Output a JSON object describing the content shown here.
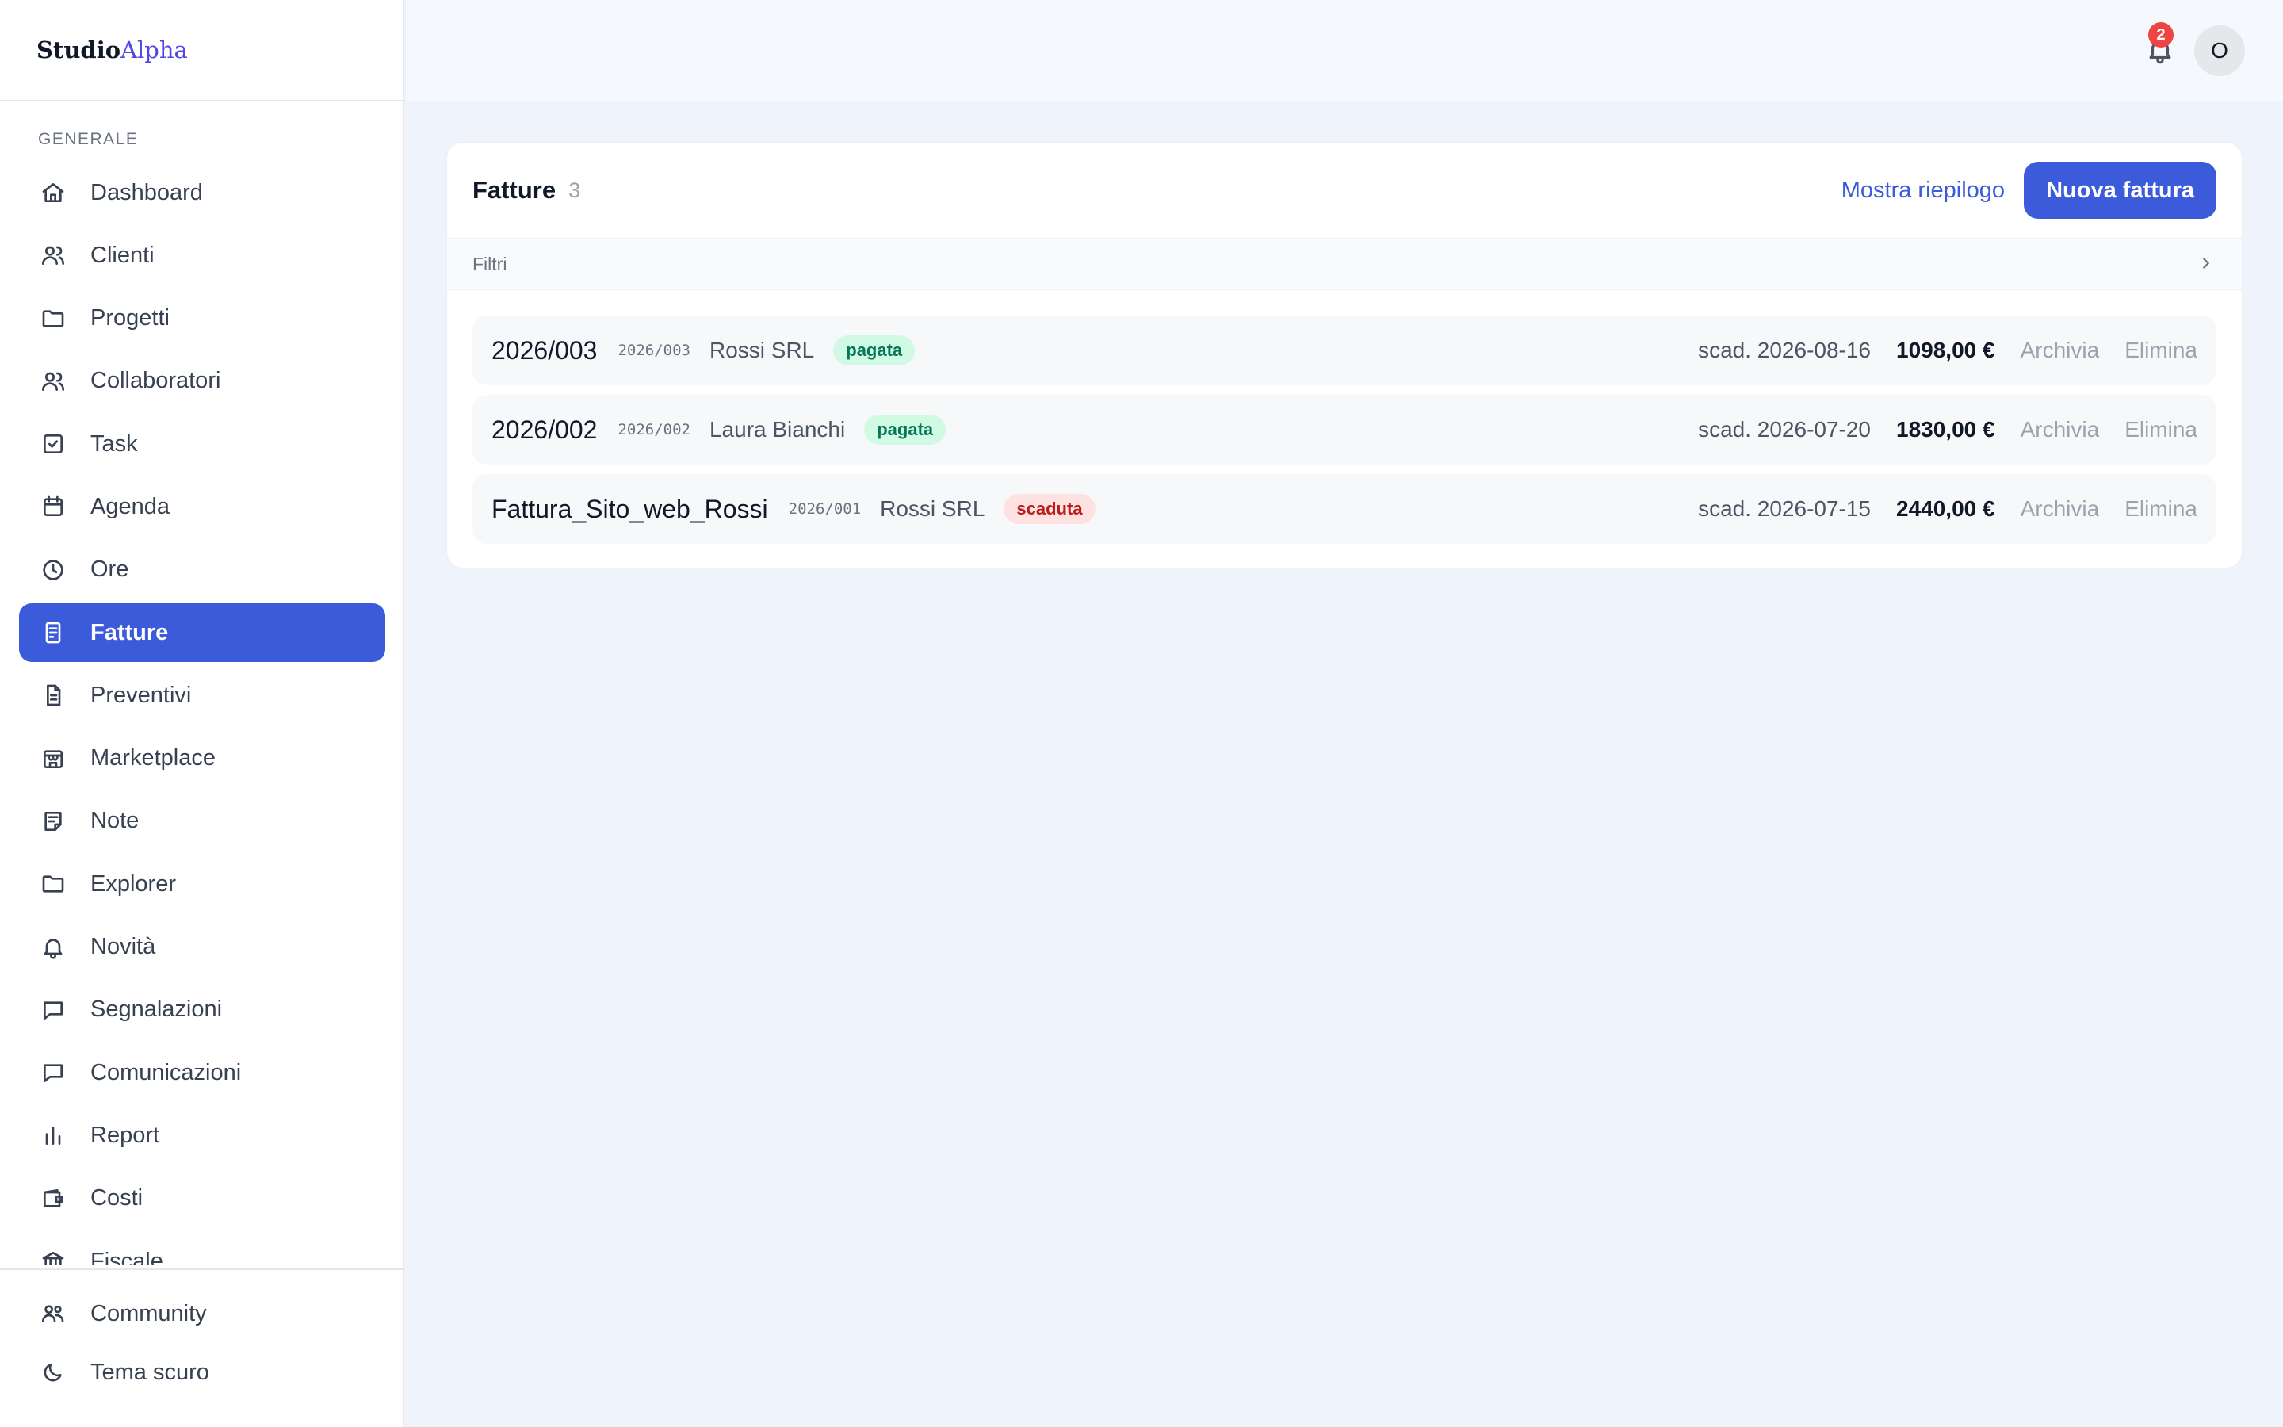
{
  "brand": {
    "part1": "Studio",
    "part2": "Alpha"
  },
  "sidebar": {
    "section_label": "GENERALE",
    "items": [
      {
        "label": "Dashboard",
        "icon": "home-icon"
      },
      {
        "label": "Clienti",
        "icon": "users-icon"
      },
      {
        "label": "Progetti",
        "icon": "folder-icon"
      },
      {
        "label": "Collaboratori",
        "icon": "users-icon"
      },
      {
        "label": "Task",
        "icon": "checkbox-icon"
      },
      {
        "label": "Agenda",
        "icon": "calendar-icon"
      },
      {
        "label": "Ore",
        "icon": "clock-icon"
      },
      {
        "label": "Fatture",
        "icon": "invoice-icon",
        "active": true
      },
      {
        "label": "Preventivi",
        "icon": "document-icon"
      },
      {
        "label": "Marketplace",
        "icon": "store-icon"
      },
      {
        "label": "Note",
        "icon": "note-icon"
      },
      {
        "label": "Explorer",
        "icon": "folder-icon"
      },
      {
        "label": "Novità",
        "icon": "bell-icon"
      },
      {
        "label": "Segnalazioni",
        "icon": "message-icon"
      },
      {
        "label": "Comunicazioni",
        "icon": "message-icon"
      },
      {
        "label": "Report",
        "icon": "bar-chart-icon"
      },
      {
        "label": "Costi",
        "icon": "wallet-icon"
      },
      {
        "label": "Fiscale",
        "icon": "bank-icon"
      }
    ],
    "bottom": [
      {
        "label": "Community",
        "icon": "community-icon"
      },
      {
        "label": "Tema scuro",
        "icon": "moon-icon"
      }
    ]
  },
  "topbar": {
    "notification_count": "2",
    "avatar_initial": "O"
  },
  "invoices": {
    "title": "Fatture",
    "count": "3",
    "summary_link": "Mostra riepilogo",
    "new_button": "Nuova fattura",
    "filters_label": "Filtri",
    "rows": [
      {
        "title": "2026/003",
        "code": "2026/003",
        "client": "Rossi SRL",
        "status": "pagata",
        "due": "scad. 2026-08-16",
        "amount": "1098,00 €",
        "archive": "Archivia",
        "delete": "Elimina"
      },
      {
        "title": "2026/002",
        "code": "2026/002",
        "client": "Laura Bianchi",
        "status": "pagata",
        "due": "scad. 2026-07-20",
        "amount": "1830,00 €",
        "archive": "Archivia",
        "delete": "Elimina"
      },
      {
        "title": "Fattura_Sito_web_Rossi",
        "code": "2026/001",
        "client": "Rossi SRL",
        "status": "scaduta",
        "due": "scad. 2026-07-15",
        "amount": "2440,00 €",
        "archive": "Archivia",
        "delete": "Elimina"
      }
    ]
  },
  "colors": {
    "accent": "#3b5bdb",
    "paid_bg": "#d1fae5",
    "paid_text": "#047857",
    "overdue_bg": "#fee2e2",
    "overdue_text": "#b91c1c",
    "badge": "#ef4444"
  }
}
